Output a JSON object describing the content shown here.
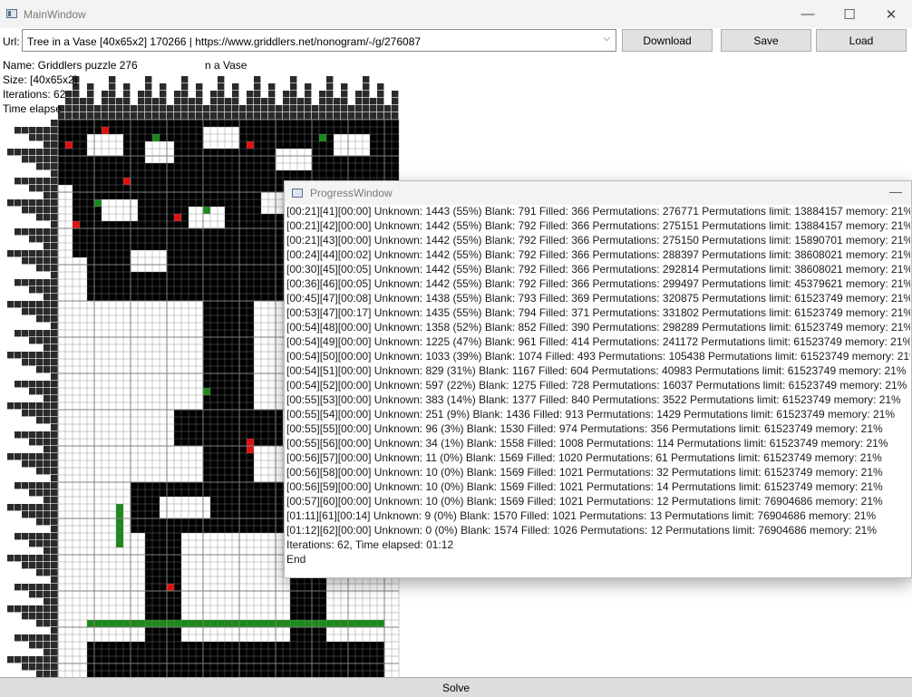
{
  "window": {
    "title": "MainWindow",
    "minimize_glyph": "—",
    "maximize_glyph": "☐",
    "close_glyph": "✕"
  },
  "toolbar": {
    "url_label": "Url:",
    "url_value": "Tree in a Vase [40x65x2] 170266 | https://www.griddlers.net/nonogram/-/g/276087",
    "dropdown_glyph": "⌵",
    "download_label": "Download",
    "save_label": "Save",
    "load_label": "Load"
  },
  "info": {
    "name": "Name: Griddlers puzzle 276",
    "name_tail": "n a Vase",
    "size": "Size: [40x65x2]",
    "iterations": "Iterations: 62",
    "time": "Time elapse"
  },
  "solve_label": "Solve",
  "colors": {
    "filled": "#000000",
    "green": "#1a8a1a",
    "red": "#e01010",
    "grid": "#7f7f7f"
  },
  "progress_window": {
    "title": "ProgressWindow",
    "minimize_glyph": "—",
    "lines": [
      "[00:21][41][00:00] Unknown: 1443 (55%) Blank: 791 Filled: 366 Permutations: 276771 Permutations limit: 13884157 memory: 21%",
      "[00:21][42][00:00] Unknown: 1442 (55%) Blank: 792 Filled: 366 Permutations: 275151 Permutations limit: 13884157 memory: 21%",
      "[00:21][43][00:00] Unknown: 1442 (55%) Blank: 792 Filled: 366 Permutations: 275150 Permutations limit: 15890701 memory: 21%",
      "[00:24][44][00:02] Unknown: 1442 (55%) Blank: 792 Filled: 366 Permutations: 288397 Permutations limit: 38608021 memory: 21%",
      "[00:30][45][00:05] Unknown: 1442 (55%) Blank: 792 Filled: 366 Permutations: 292814 Permutations limit: 38608021 memory: 21%",
      "[00:36][46][00:05] Unknown: 1442 (55%) Blank: 792 Filled: 366 Permutations: 299497 Permutations limit: 45379621 memory: 21%",
      "[00:45][47][00:08] Unknown: 1438 (55%) Blank: 793 Filled: 369 Permutations: 320875 Permutations limit: 61523749 memory: 21%",
      "[00:53][47][00:17] Unknown: 1435 (55%) Blank: 794 Filled: 371 Permutations: 331802 Permutations limit: 61523749 memory: 21%",
      "[00:54][48][00:00] Unknown: 1358 (52%) Blank: 852 Filled: 390 Permutations: 298289 Permutations limit: 61523749 memory: 21%",
      "[00:54][49][00:00] Unknown: 1225 (47%) Blank: 961 Filled: 414 Permutations: 241172 Permutations limit: 61523749 memory: 21%",
      "[00:54][50][00:00] Unknown: 1033 (39%) Blank: 1074 Filled: 493 Permutations: 105438 Permutations limit: 61523749 memory: 21%",
      "[00:54][51][00:00] Unknown: 829 (31%) Blank: 1167 Filled: 604 Permutations: 40983 Permutations limit: 61523749 memory: 21%",
      "[00:54][52][00:00] Unknown: 597 (22%) Blank: 1275 Filled: 728 Permutations: 16037 Permutations limit: 61523749 memory: 21%",
      "[00:55][53][00:00] Unknown: 383 (14%) Blank: 1377 Filled: 840 Permutations: 3522 Permutations limit: 61523749 memory: 21%",
      "[00:55][54][00:00] Unknown: 251 (9%) Blank: 1436 Filled: 913 Permutations: 1429 Permutations limit: 61523749 memory: 21%",
      "[00:55][55][00:00] Unknown: 96 (3%) Blank: 1530 Filled: 974 Permutations: 356 Permutations limit: 61523749 memory: 21%",
      "[00:55][56][00:00] Unknown: 34 (1%) Blank: 1558 Filled: 1008 Permutations: 114 Permutations limit: 61523749 memory: 21%",
      "[00:56][57][00:00] Unknown: 11 (0%) Blank: 1569 Filled: 1020 Permutations: 61 Permutations limit: 61523749 memory: 21%",
      "[00:56][58][00:00] Unknown: 10 (0%) Blank: 1569 Filled: 1021 Permutations: 32 Permutations limit: 61523749 memory: 21%",
      "[00:56][59][00:00] Unknown: 10 (0%) Blank: 1569 Filled: 1021 Permutations: 14 Permutations limit: 61523749 memory: 21%",
      "[00:57][60][00:00] Unknown: 10 (0%) Blank: 1569 Filled: 1021 Permutations: 12 Permutations limit: 76904686 memory: 21%",
      "[01:11][61][00:14] Unknown: 9 (0%) Blank: 1570 Filled: 1021 Permutations: 13 Permutations limit: 76904686 memory: 21%",
      "[01:12][62][00:00] Unknown: 0 (0%) Blank: 1574 Filled: 1026 Permutations: 12 Permutations limit: 76904686 memory: 21%",
      "Iterations: 62, Time elapsed: 01:12",
      "End"
    ]
  }
}
